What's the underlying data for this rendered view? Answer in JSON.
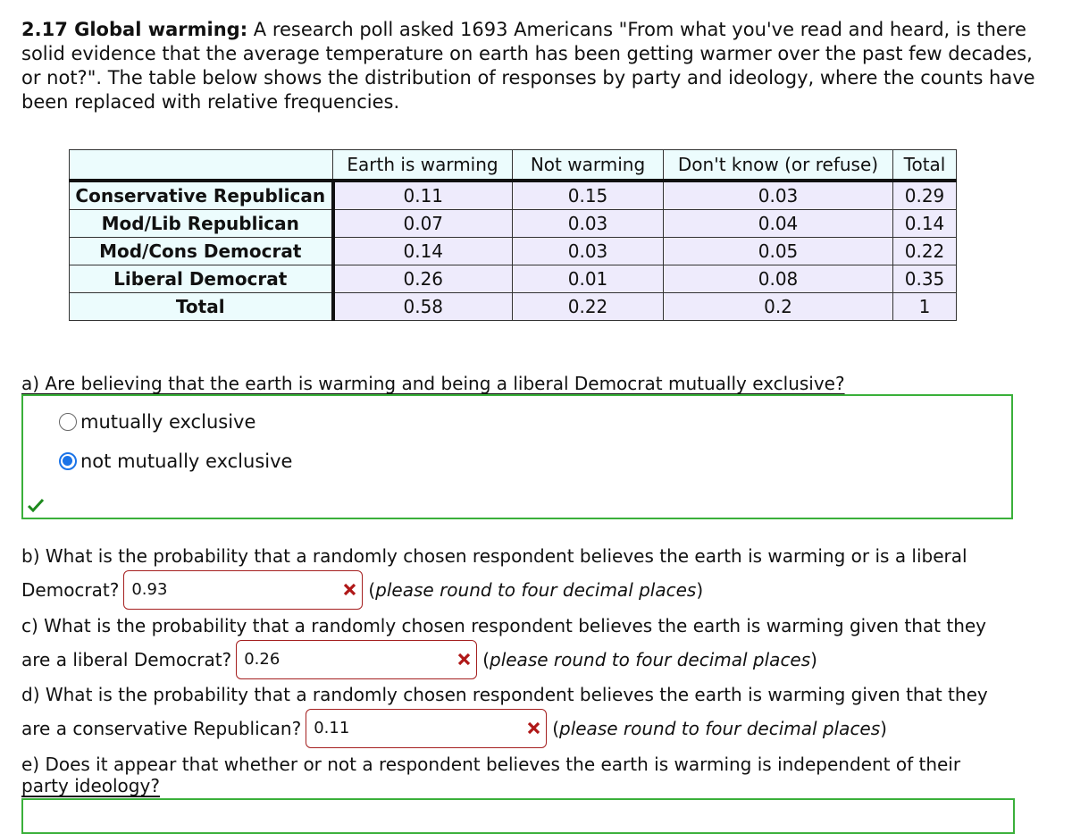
{
  "problem": {
    "number_title": "2.17 Global warming:",
    "intro": "A research poll asked 1693 Americans \"From what you've read and heard, is there solid evidence that the average temperature on earth has been getting warmer over the past few decades, or not?\". The table below shows the distribution of responses by party and ideology, where the counts have been replaced with relative frequencies."
  },
  "table": {
    "columns": [
      "",
      "Earth is warming",
      "Not warming",
      "Don't know (or refuse)",
      "Total"
    ],
    "rows": [
      {
        "label": "Conservative Republican",
        "values": [
          "0.11",
          "0.15",
          "0.03",
          "0.29"
        ]
      },
      {
        "label": "Mod/Lib Republican",
        "values": [
          "0.07",
          "0.03",
          "0.04",
          "0.14"
        ]
      },
      {
        "label": "Mod/Cons Democrat",
        "values": [
          "0.14",
          "0.03",
          "0.05",
          "0.22"
        ]
      },
      {
        "label": "Liberal Democrat",
        "values": [
          "0.26",
          "0.01",
          "0.08",
          "0.35"
        ]
      },
      {
        "label": "Total",
        "values": [
          "0.58",
          "0.22",
          "0.2",
          "1"
        ]
      }
    ]
  },
  "part_a": {
    "question": "a) Are believing that the earth is warming and being a liberal Democrat mutually exclusive?",
    "options": [
      {
        "label": "mutually exclusive",
        "selected": false
      },
      {
        "label": "not mutually exclusive",
        "selected": true
      }
    ],
    "status": "correct"
  },
  "part_b": {
    "question_line1": "b) What is the probability that a randomly chosen respondent believes the earth is warming or is a liberal",
    "question_line2": "Democrat?",
    "value": "0.93",
    "status": "incorrect",
    "hint_open": "(",
    "hint": "please round to four decimal places",
    "hint_close": ")"
  },
  "part_c": {
    "question_line1": "c) What is the probability that a randomly chosen respondent believes the earth is warming given that they",
    "question_line2": "are a liberal Democrat?",
    "value": "0.26",
    "status": "incorrect",
    "hint_open": "(",
    "hint": "please round to four decimal places",
    "hint_close": ")"
  },
  "part_d": {
    "question_line1": "d) What is the probability that a randomly chosen respondent believes the earth is warming given that they",
    "question_line2": "are a conservative Republican?",
    "value": "0.11",
    "status": "incorrect",
    "hint_open": "(",
    "hint": "please round to four decimal places",
    "hint_close": ")"
  },
  "part_e": {
    "question_line1": "e) Does it appear that whether or not a respondent believes the earth is warming is independent of their",
    "question_line2": "party ideology?"
  },
  "colors": {
    "correct_green": "#3ab03a",
    "incorrect_red": "#a52020",
    "radio_blue": "#1a73e8",
    "header_bg": "#ecfcfd",
    "cell_bg": "#eeebfc"
  }
}
